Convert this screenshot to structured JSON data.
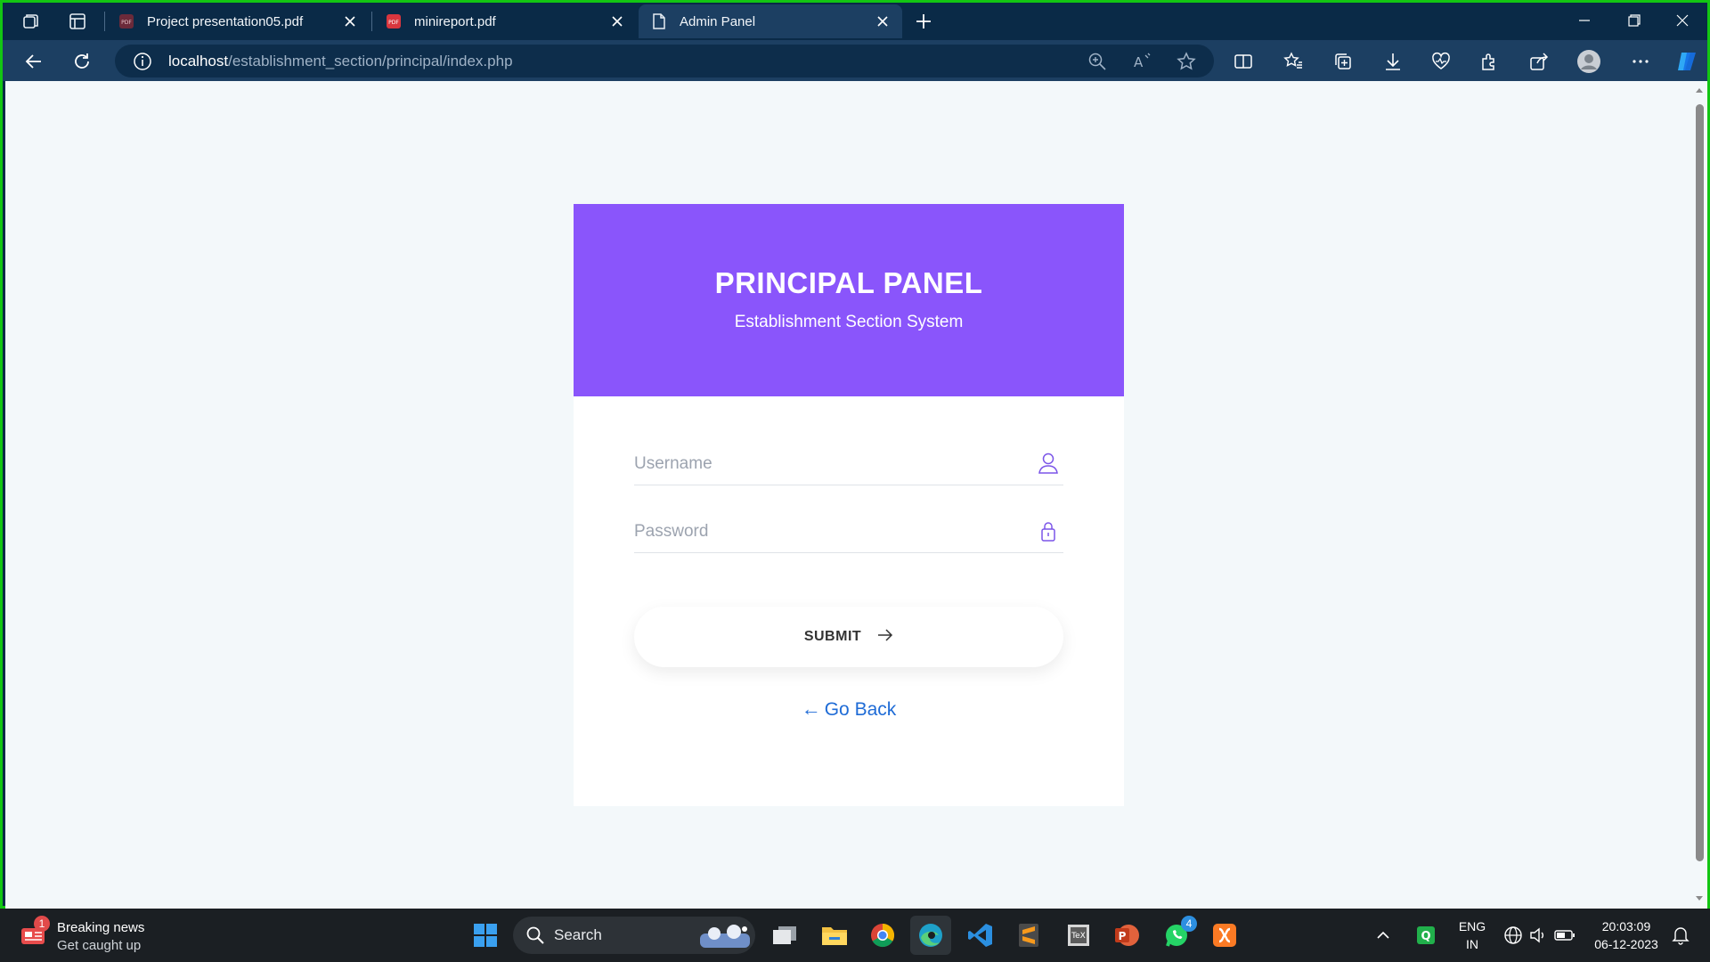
{
  "browser": {
    "tabs": [
      {
        "title": "Project presentation05.pdf",
        "icon": "pdf-icon",
        "active": false
      },
      {
        "title": "minireport.pdf",
        "icon": "pdf-icon",
        "active": false
      },
      {
        "title": "Admin Panel",
        "icon": "page-icon",
        "active": true
      }
    ],
    "address": {
      "host": "localhost",
      "path": "/establishment_section/principal/index.php"
    }
  },
  "login": {
    "title": "PRINCIPAL PANEL",
    "subtitle": "Establishment Section System",
    "username_placeholder": "Username",
    "password_placeholder": "Password",
    "submit_label": "SUBMIT",
    "go_back_label": "Go Back",
    "accent_color": "#8a55fb",
    "link_color": "#1e6bd6"
  },
  "taskbar": {
    "news_badge": "1",
    "news_title": "Breaking news",
    "news_sub": "Get caught up",
    "search_label": "Search",
    "whatsapp_badge": "4",
    "lang_top": "ENG",
    "lang_bottom": "IN",
    "time": "20:03:09",
    "date": "06-12-2023"
  }
}
